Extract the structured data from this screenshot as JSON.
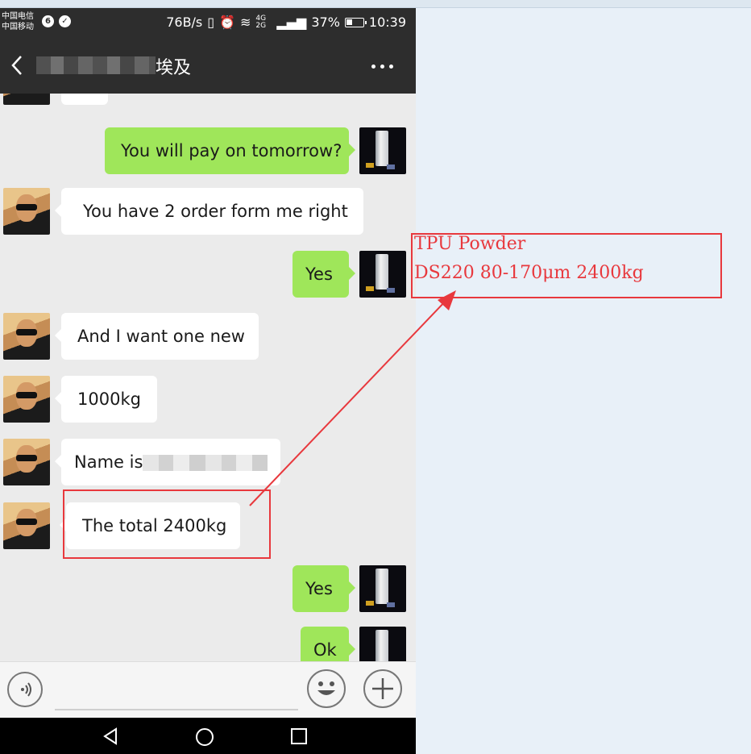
{
  "status_bar": {
    "carrier1": "中国电信",
    "carrier2": "中国移动",
    "speed": "76B/s",
    "network": "4G 2G",
    "battery": "37%",
    "time": "10:39"
  },
  "header": {
    "title": "埃及"
  },
  "messages": [
    {
      "side": "right",
      "text": "You will pay on tomorrow?"
    },
    {
      "side": "left",
      "text": "You have 2 order  form me right"
    },
    {
      "side": "right",
      "text": "Yes"
    },
    {
      "side": "left",
      "text": "And I want one  new"
    },
    {
      "side": "left",
      "text": "1000kg"
    },
    {
      "side": "left",
      "text": "Name is"
    },
    {
      "side": "left",
      "text": "The  total 2400kg"
    },
    {
      "side": "right",
      "text": "Yes"
    },
    {
      "side": "right",
      "text": "Ok"
    }
  ],
  "annotation": {
    "line1": "TPU Powder",
    "line2": "DS220 80-170μm 2400kg",
    "color": "#e8383d"
  }
}
